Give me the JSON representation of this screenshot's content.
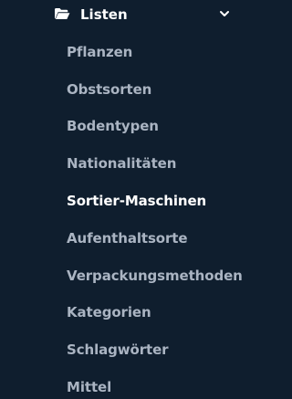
{
  "section": {
    "label": "Listen",
    "icon": "folder-open-icon",
    "toggle_icon": "chevron-down-icon",
    "expanded": true
  },
  "items": [
    {
      "label": "Pflanzen",
      "active": false
    },
    {
      "label": "Obstsorten",
      "active": false
    },
    {
      "label": "Bodentypen",
      "active": false
    },
    {
      "label": "Nationalitäten",
      "active": false
    },
    {
      "label": "Sortier-Maschinen",
      "active": true
    },
    {
      "label": "Aufenthaltsorte",
      "active": false
    },
    {
      "label": "Verpackungsmethoden",
      "active": false
    },
    {
      "label": "Kategorien",
      "active": false
    },
    {
      "label": "Schlagwörter",
      "active": false
    },
    {
      "label": "Mittel",
      "active": false
    }
  ],
  "colors": {
    "background": "#0f1e2e",
    "text_default": "#aab4c2",
    "text_active": "#ffffff"
  }
}
